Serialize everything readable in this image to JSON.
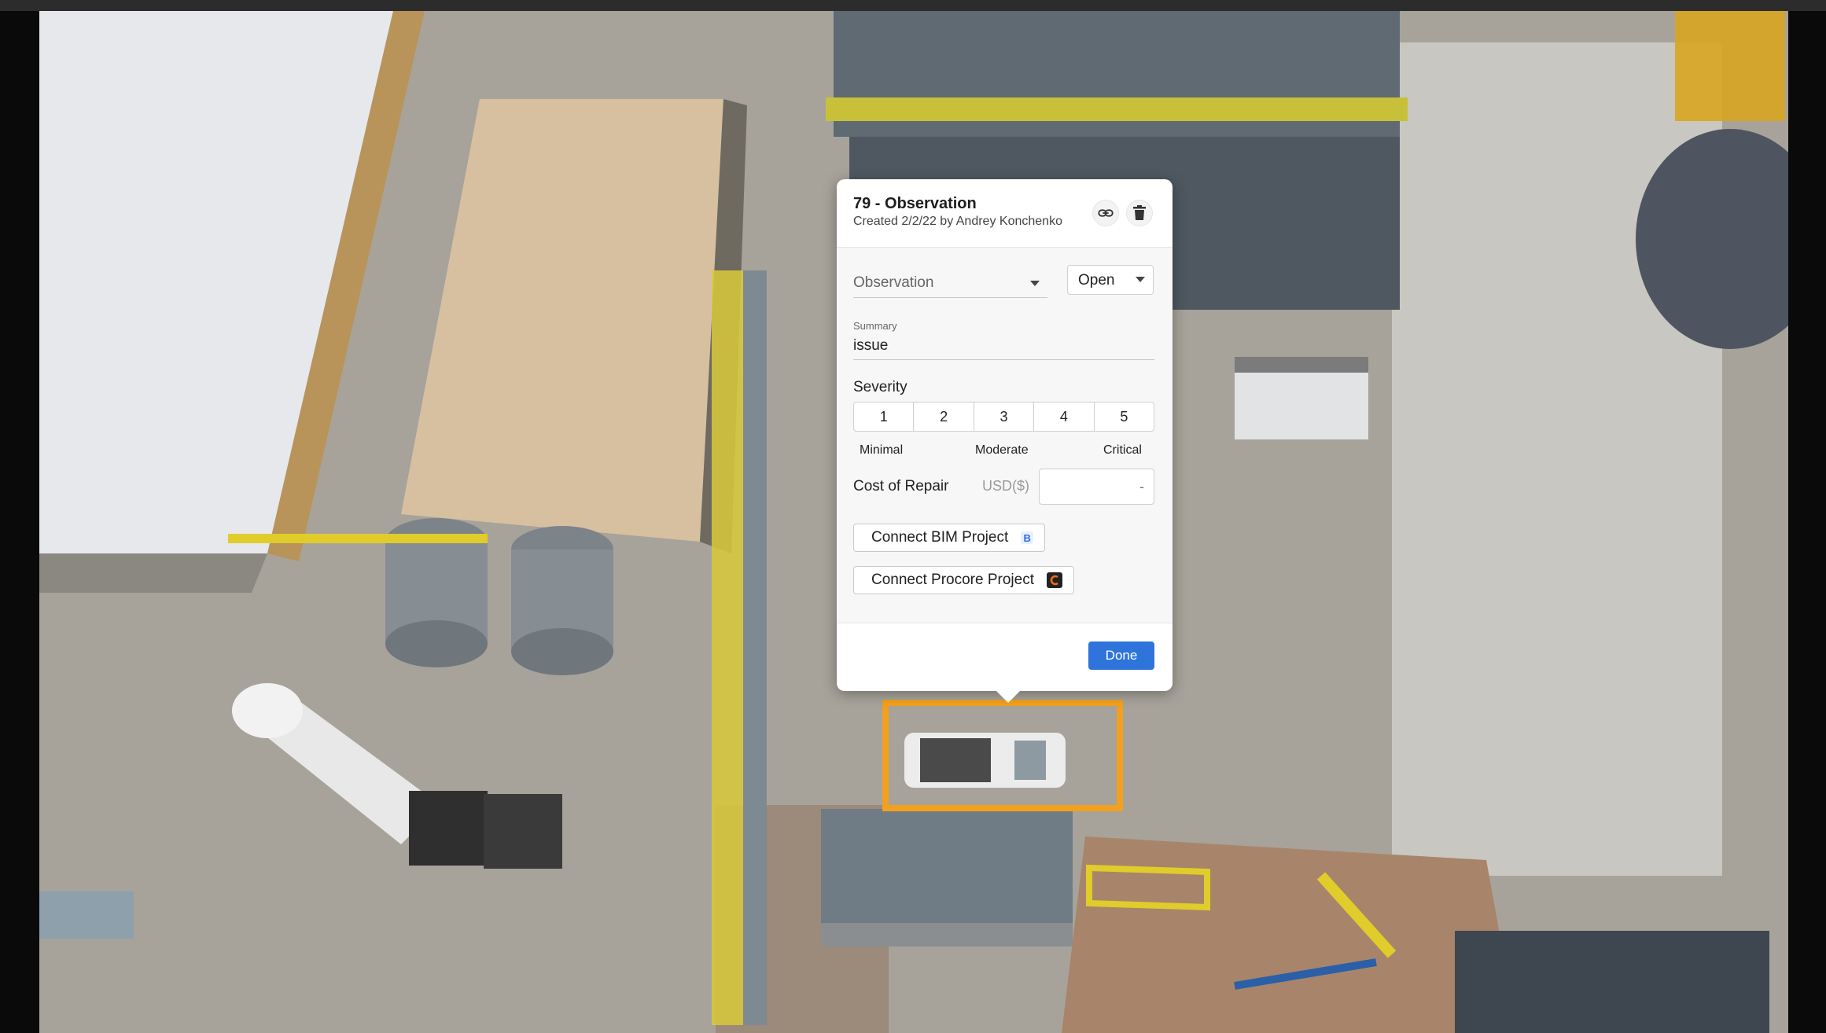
{
  "popup": {
    "title": "79 - Observation",
    "subtitle": "Created 2/2/22 by Andrey Konchenko",
    "type_value": "Observation",
    "status_value": "Open",
    "summary_label": "Summary",
    "summary_value": "issue",
    "severity_label": "Severity",
    "severity_options": [
      "1",
      "2",
      "3",
      "4",
      "5"
    ],
    "severity_captions": {
      "low": "Minimal",
      "mid": "Moderate",
      "high": "Critical"
    },
    "cost_label": "Cost of Repair",
    "cost_currency": "USD($)",
    "cost_placeholder": "-",
    "connect_bim_label": "Connect BIM Project",
    "bim_badge": "B",
    "connect_procore_label": "Connect Procore Project",
    "done_label": "Done"
  },
  "icons": {
    "link": "link-icon",
    "delete": "trash-icon"
  },
  "colors": {
    "selection": "#f2a01e",
    "primary": "#2f74da"
  }
}
